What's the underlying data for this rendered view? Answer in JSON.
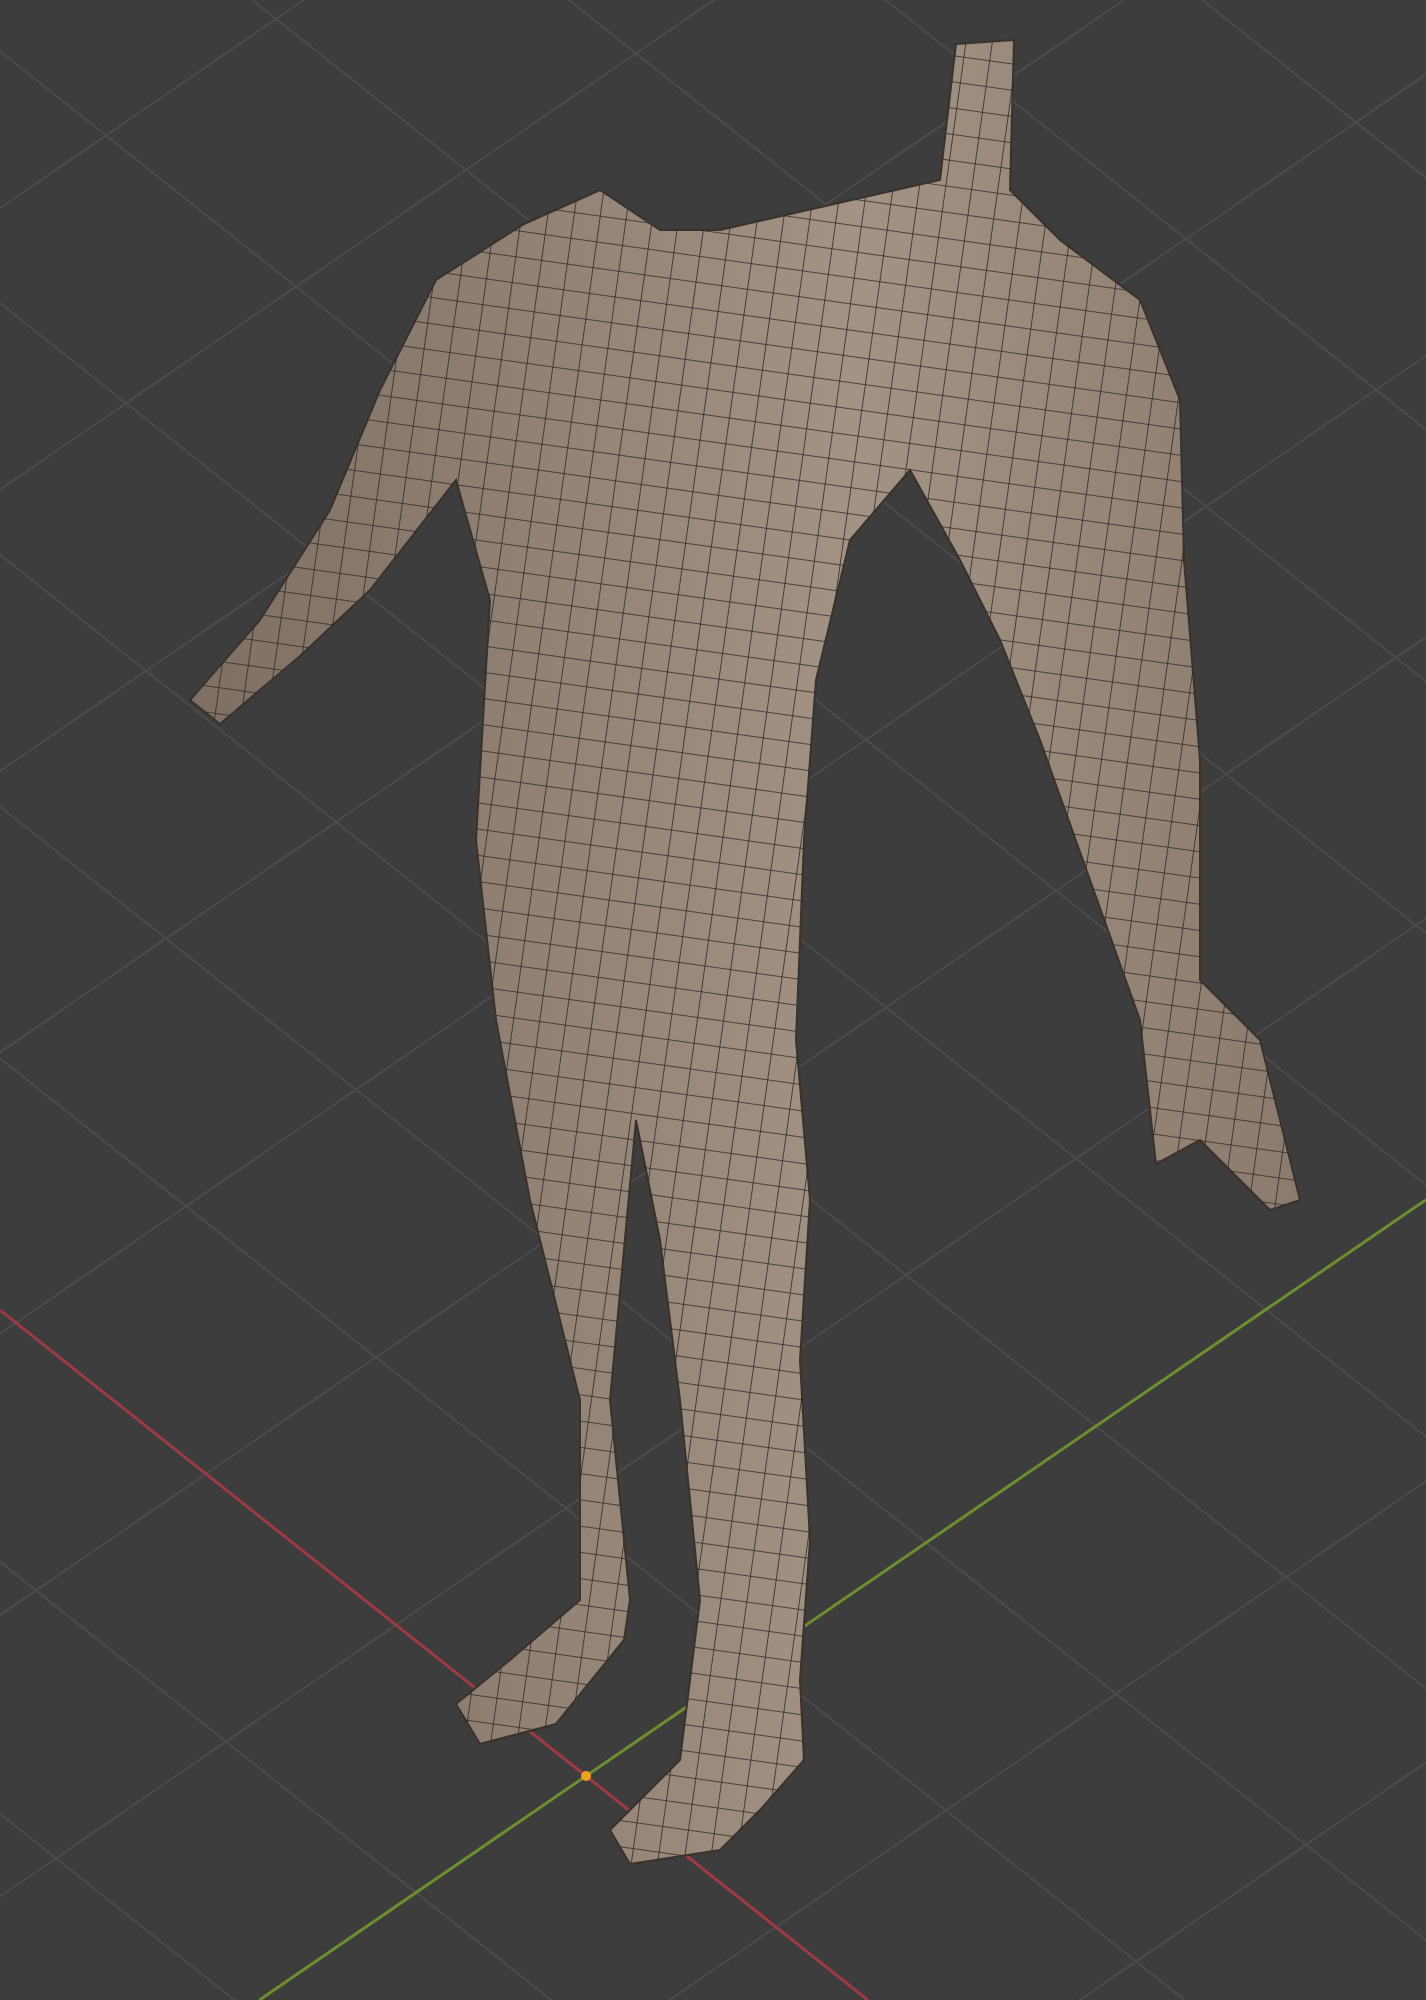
{
  "viewport": {
    "axes": [
      {
        "kind": "x",
        "color": "#9e3a44"
      },
      {
        "kind": "y",
        "color": "#6b8f2e"
      }
    ]
  }
}
